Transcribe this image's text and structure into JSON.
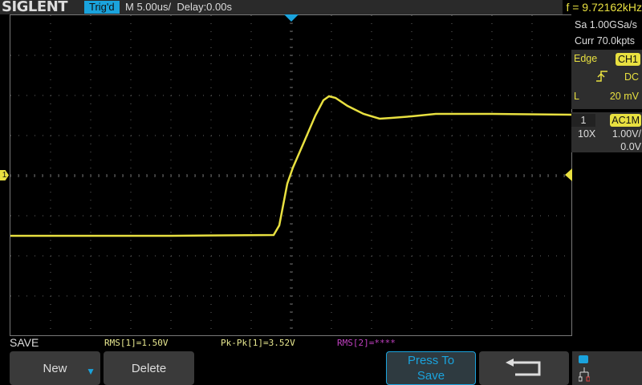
{
  "header": {
    "brand": "SIGLENT",
    "trigger_status": "Trig'd",
    "timebase": "M 5.00us/",
    "delay": "Delay:0.00s",
    "frequency": "f = 9.72162kHz"
  },
  "acquisition": {
    "sample_rate": "Sa 1.00GSa/s",
    "memory": "Curr 70.0kpts"
  },
  "trigger": {
    "type": "Edge",
    "source": "CH1",
    "slope_icon": "rising-edge-icon",
    "coupling": "DC",
    "level_label": "L",
    "level": "20 mV"
  },
  "channel": {
    "number": "1",
    "coupling": "AC1M",
    "probe": "10X",
    "scale": "1.00V/",
    "offset": "0.0V"
  },
  "measurements": {
    "mode": "SAVE",
    "rms1": "RMS[1]=1.50V",
    "pkpk1": "Pk-Pk[1]=3.52V",
    "rms2": "RMS[2]=****"
  },
  "softkeys": {
    "new": "New",
    "delete": "Delete",
    "press_to_save": "Press To Save",
    "back_icon": "return-arrow-icon"
  },
  "colors": {
    "ch1": "#e8e040",
    "accent": "#1aa3dd",
    "ch2": "#c040c0"
  },
  "channel_marker": "1"
}
